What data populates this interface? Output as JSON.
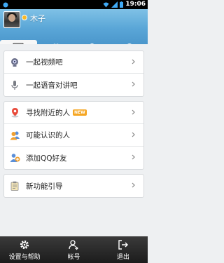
{
  "status_bar": {
    "time": "19:06"
  },
  "profile": {
    "nickname": "木子",
    "status_color": "#f7b928"
  },
  "tabs": [
    {
      "name": "home",
      "icon": "desk-icon",
      "active": true
    },
    {
      "name": "contacts",
      "icon": "contacts-icon",
      "active": false
    },
    {
      "name": "notifications",
      "icon": "bell-icon",
      "active": false
    },
    {
      "name": "recent",
      "icon": "clock-icon",
      "active": false
    }
  ],
  "menu": {
    "group1": [
      {
        "label": "一起视频吧",
        "icon": "video-call-icon"
      },
      {
        "label": "一起语音对讲吧",
        "icon": "microphone-icon"
      }
    ],
    "group2": [
      {
        "label": "寻找附近的人",
        "icon": "location-pin-icon",
        "badge": "NEW"
      },
      {
        "label": "可能认识的人",
        "icon": "people-icon"
      },
      {
        "label": "添加QQ好友",
        "icon": "add-friend-icon"
      }
    ],
    "group3": [
      {
        "label": "新功能引导",
        "icon": "clipboard-icon"
      }
    ]
  },
  "bottom_bar": {
    "settings": "设置与帮助",
    "account": "帐号",
    "exit": "退出"
  }
}
